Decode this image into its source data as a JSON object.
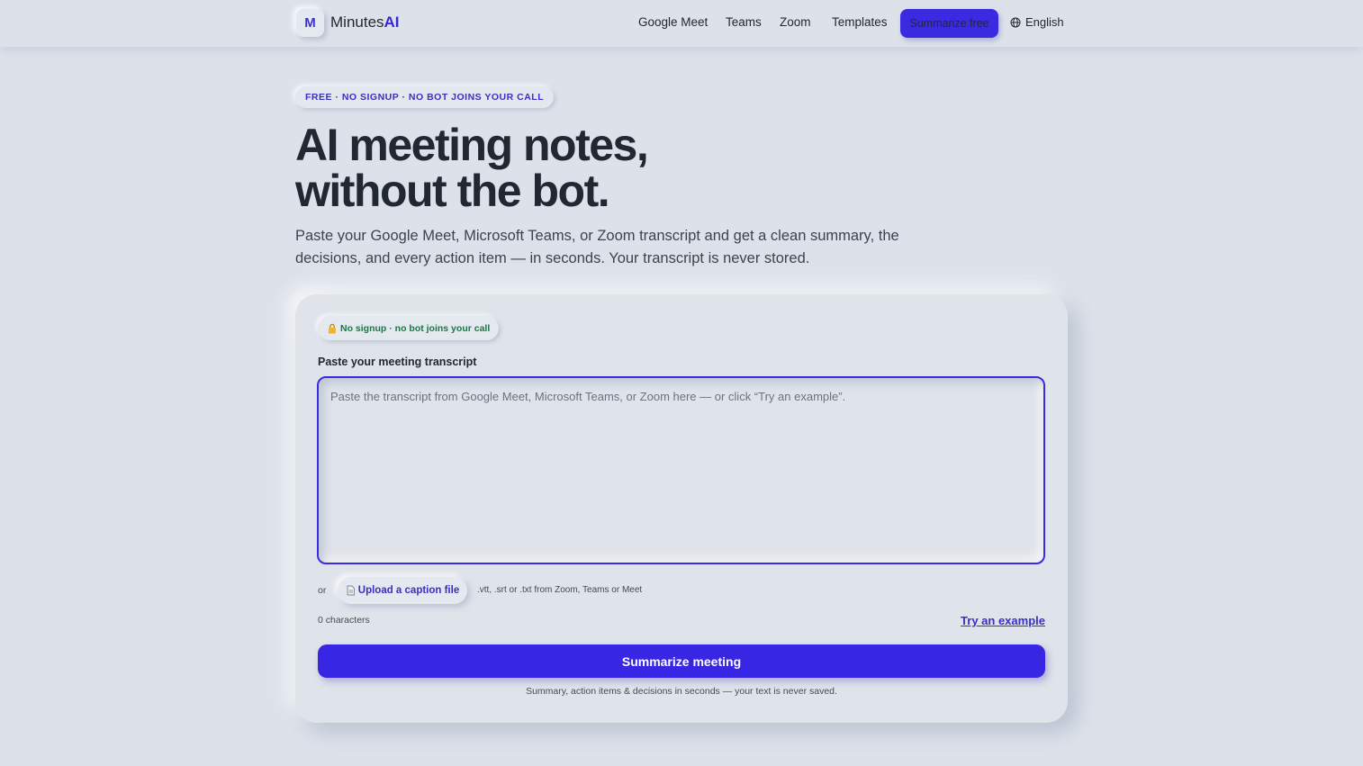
{
  "header": {
    "logo_mark": "M",
    "logo_text": "Minutes",
    "logo_accent": "AI",
    "nav": [
      "Google Meet",
      "Teams",
      "Zoom",
      "Templates"
    ],
    "cta_label": "Summarize free",
    "language": "English",
    "icons": {
      "language": "globe-icon"
    }
  },
  "hero": {
    "pill": "FREE · NO SIGNUP · NO BOT JOINS YOUR CALL",
    "title_line1": "AI meeting notes,",
    "title_line2": "without the bot.",
    "subtitle": "Paste your Google Meet, Microsoft Teams, or Zoom transcript and get a clean summary, the decisions, and every action item — in seconds. Your transcript is never stored."
  },
  "form": {
    "badge": "No signup · no bot joins your call",
    "badge_icon": "lock-icon",
    "label": "Paste your meeting transcript",
    "placeholder": "Paste the transcript from Google Meet, Microsoft Teams, or Zoom here — or click “Try an example”.",
    "or_text": "or",
    "upload_label": "Upload a caption file",
    "upload_icon": "file-icon",
    "upload_hint": ".vtt, .srt or .txt from Zoom, Teams or Meet",
    "char_count": "0 characters",
    "try_example": "Try an example",
    "submit_label": "Summarize meeting",
    "footnote": "Summary, action items & decisions in seconds — your text is never saved."
  },
  "colors": {
    "background": "#dde2ea",
    "accent": "#3a2be0",
    "badge_green": "#177a45"
  }
}
